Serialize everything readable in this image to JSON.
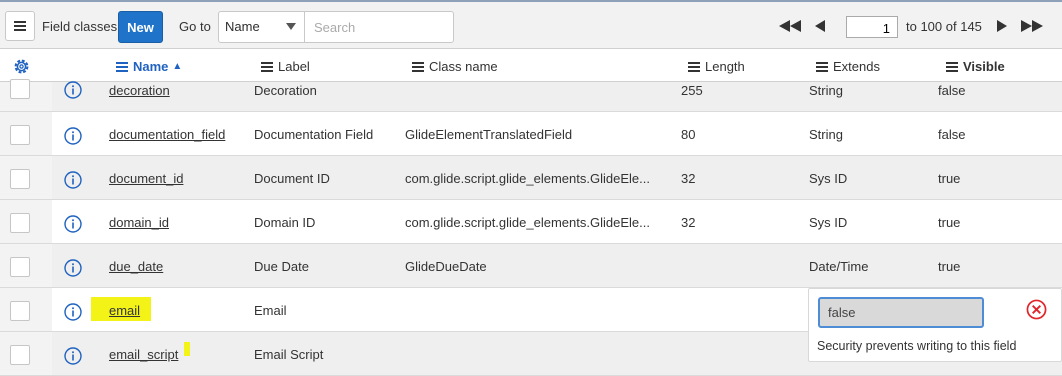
{
  "toolbar": {
    "menu_icon": "hamburger-icon",
    "title": "Field classes",
    "new_label": "New",
    "goto_label": "Go to",
    "goto_selected": "Name",
    "search_placeholder": "Search",
    "page_value": "1",
    "range_text": "to 100 of 145"
  },
  "header": {
    "settings_icon": "gear-icon",
    "columns": [
      {
        "label": "Name",
        "sorted": "ascending"
      },
      {
        "label": "Label"
      },
      {
        "label": "Class name"
      },
      {
        "label": "Length"
      },
      {
        "label": "Extends"
      },
      {
        "label": "Visible"
      }
    ]
  },
  "rows": [
    {
      "name": "decoration",
      "label": "Decoration",
      "class_name": "",
      "length": "255",
      "extends": "String",
      "visible": "false"
    },
    {
      "name": "documentation_field",
      "label": "Documentation Field",
      "class_name": "GlideElementTranslatedField",
      "length": "80",
      "extends": "String",
      "visible": "false"
    },
    {
      "name": "document_id",
      "label": "Document ID",
      "class_name": "com.glide.script.glide_elements.GlideEle...",
      "length": "32",
      "extends": "Sys ID",
      "visible": "true"
    },
    {
      "name": "domain_id",
      "label": "Domain ID",
      "class_name": "com.glide.script.glide_elements.GlideEle...",
      "length": "32",
      "extends": "Sys ID",
      "visible": "true"
    },
    {
      "name": "due_date",
      "label": "Due Date",
      "class_name": "GlideDueDate",
      "length": "",
      "extends": "Date/Time",
      "visible": "true"
    },
    {
      "name": "email",
      "label": "Email",
      "class_name": "",
      "length": "",
      "extends": "",
      "visible": ""
    },
    {
      "name": "email_script",
      "label": "Email Script",
      "class_name": "",
      "length": "",
      "extends": "",
      "visible": ""
    }
  ],
  "popover": {
    "value": "false",
    "message": "Security prevents writing to this field"
  },
  "colors": {
    "accent": "#1f74c9",
    "sort_header": "#1f62c0",
    "highlight": "#f3f318",
    "error": "#e0262b"
  }
}
